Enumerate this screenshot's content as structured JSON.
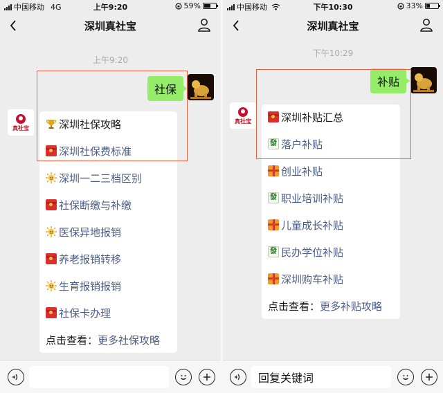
{
  "left": {
    "status": {
      "carrier": "中国移动",
      "network": "4G",
      "time": "上午9:20",
      "battery": "59%",
      "battery_fraction": 0.59
    },
    "nav": {
      "title": "深圳真社宝"
    },
    "timestamp": "上午9:20",
    "sent_message": "社保",
    "bot_logo_text": "真社宝",
    "menu": [
      {
        "icon": "trophy-icon",
        "label": "深圳社保攻略",
        "style": "dark"
      },
      {
        "icon": "red-envelope-icon",
        "label": "深圳社保费标准",
        "style": "link"
      },
      {
        "icon": "sun-icon",
        "label": "深圳一二三档区别",
        "style": "link"
      },
      {
        "icon": "red-envelope-icon",
        "label": "社保断缴与补缴",
        "style": "link"
      },
      {
        "icon": "sun-icon",
        "label": "医保异地报销",
        "style": "link"
      },
      {
        "icon": "red-envelope-icon",
        "label": "养老报销转移",
        "style": "link"
      },
      {
        "icon": "sun-icon",
        "label": "生育报销报销",
        "style": "link"
      },
      {
        "icon": "red-envelope-icon",
        "label": "社保卡办理",
        "style": "link"
      }
    ],
    "footer": {
      "prefix": "点击查看：",
      "link": "更多社保攻略"
    },
    "input": {
      "value": ""
    }
  },
  "right": {
    "status": {
      "carrier": "中国移动",
      "network": "wifi",
      "time": "下午10:30",
      "battery": "33%",
      "battery_fraction": 0.33
    },
    "nav": {
      "title": "深圳真社宝"
    },
    "timestamp": "下午10:29",
    "sent_message": "补贴",
    "bot_logo_text": "真社宝",
    "menu": [
      {
        "icon": "red-envelope-icon",
        "label": "深圳补贴汇总",
        "style": "dark"
      },
      {
        "icon": "mahjong-tile-icon",
        "label": "落户补贴",
        "style": "link"
      },
      {
        "icon": "gift-icon",
        "label": "创业补贴",
        "style": "link"
      },
      {
        "icon": "mahjong-tile-icon",
        "label": "职业培训补贴",
        "style": "link"
      },
      {
        "icon": "gift-icon",
        "label": "儿童成长补贴",
        "style": "link"
      },
      {
        "icon": "mahjong-tile-icon",
        "label": "民办学位补贴",
        "style": "link"
      },
      {
        "icon": "gift-icon",
        "label": "深圳购车补贴",
        "style": "link"
      }
    ],
    "footer": {
      "prefix": "点击查看：",
      "link": "更多补贴攻略"
    },
    "input": {
      "value": "回复关键词"
    }
  },
  "icons": {
    "mahjong_glyph": "發"
  },
  "colors": {
    "chat_bg": "#ededed",
    "sent_bubble": "#95ec69",
    "link": "#4a5c87",
    "highlight": "#e8603c",
    "envelope": "#d9302c"
  }
}
